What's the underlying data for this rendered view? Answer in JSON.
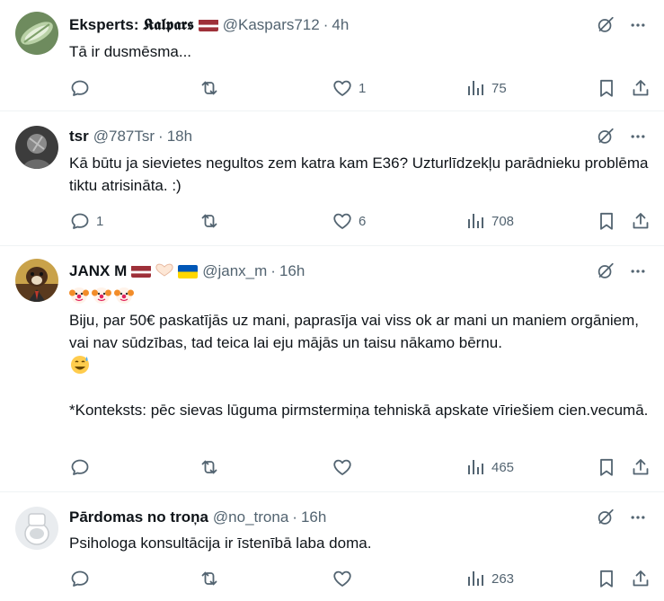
{
  "tweets": [
    {
      "name": "Eksperts: 𝕶𝖆𝖑𝖕𝖆𝖗𝖘",
      "handle": "@Kaspars712",
      "dot": "·",
      "time": "4h",
      "text": "Tā ir dusmēsma...",
      "replies": "",
      "retweets": "",
      "likes": "1",
      "views": "75"
    },
    {
      "name": "tsr",
      "handle": "@787Tsr",
      "dot": "·",
      "time": "18h",
      "text": "Kā būtu ja sievietes negultos zem katra kam E36? Uzturlīdzekļu parādnieku problēma tiktu atrisināta. :)",
      "replies": "1",
      "retweets": "",
      "likes": "6",
      "views": "708"
    },
    {
      "name": "JANX M",
      "handle": "@janx_m",
      "dot": "·",
      "time": "16h",
      "text_line1": "Biju, par 50€ paskatījās uz mani, paprasīja vai viss ok ar mani un maniem orgāniem, vai nav sūdzības, tad teica lai eju mājās un taisu nākamo bērnu.",
      "text_line2": "*Konteksts: pēc sievas lūguma pirmstermiņa tehniskā apskate vīriešiem cien.vecumā.",
      "replies": "",
      "retweets": "",
      "likes": "",
      "views": "465"
    },
    {
      "name": "Pārdomas no troņa",
      "handle": "@no_trona",
      "dot": "·",
      "time": "16h",
      "text": "Psihologa konsultācija ir īstenībā laba doma.",
      "replies": "",
      "retweets": "",
      "likes": "",
      "views": "263"
    }
  ],
  "icons": {
    "reply": "reply-icon",
    "retweet": "retweet-icon",
    "like": "heart-icon",
    "views": "views-icon",
    "bookmark": "bookmark-icon",
    "share": "share-icon",
    "grok": "grok-icon",
    "more": "more-icon",
    "clown": "🤡",
    "sweat": "😅"
  },
  "colors": {
    "text": "#0f1419",
    "secondary": "#536471",
    "divider": "#eff3f4",
    "lv_red": "#9e3039",
    "ua_blue": "#0057b7",
    "ua_yellow": "#ffd700"
  }
}
